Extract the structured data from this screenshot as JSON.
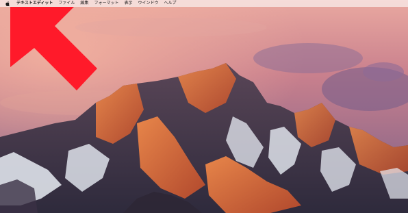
{
  "menubar": {
    "apple_icon": "apple-logo-icon",
    "items": [
      {
        "label": "テキストエディット",
        "role": "app-name"
      },
      {
        "label": "ファイル"
      },
      {
        "label": "編集"
      },
      {
        "label": "フォーマット"
      },
      {
        "label": "表示"
      },
      {
        "label": "ウインドウ"
      },
      {
        "label": "ヘルプ"
      }
    ]
  },
  "overlay": {
    "arrow_icon": "pointer-arrow-icon",
    "arrow_color": "#ff1a2a"
  },
  "wallpaper": {
    "name": "macOS Sierra mountain wallpaper",
    "sky_top": "#d98a8a",
    "sky_mid": "#b46e85",
    "mountain_glow": "#e8703c",
    "snow": "#e9edf5",
    "rock_dark": "#3a3247"
  }
}
